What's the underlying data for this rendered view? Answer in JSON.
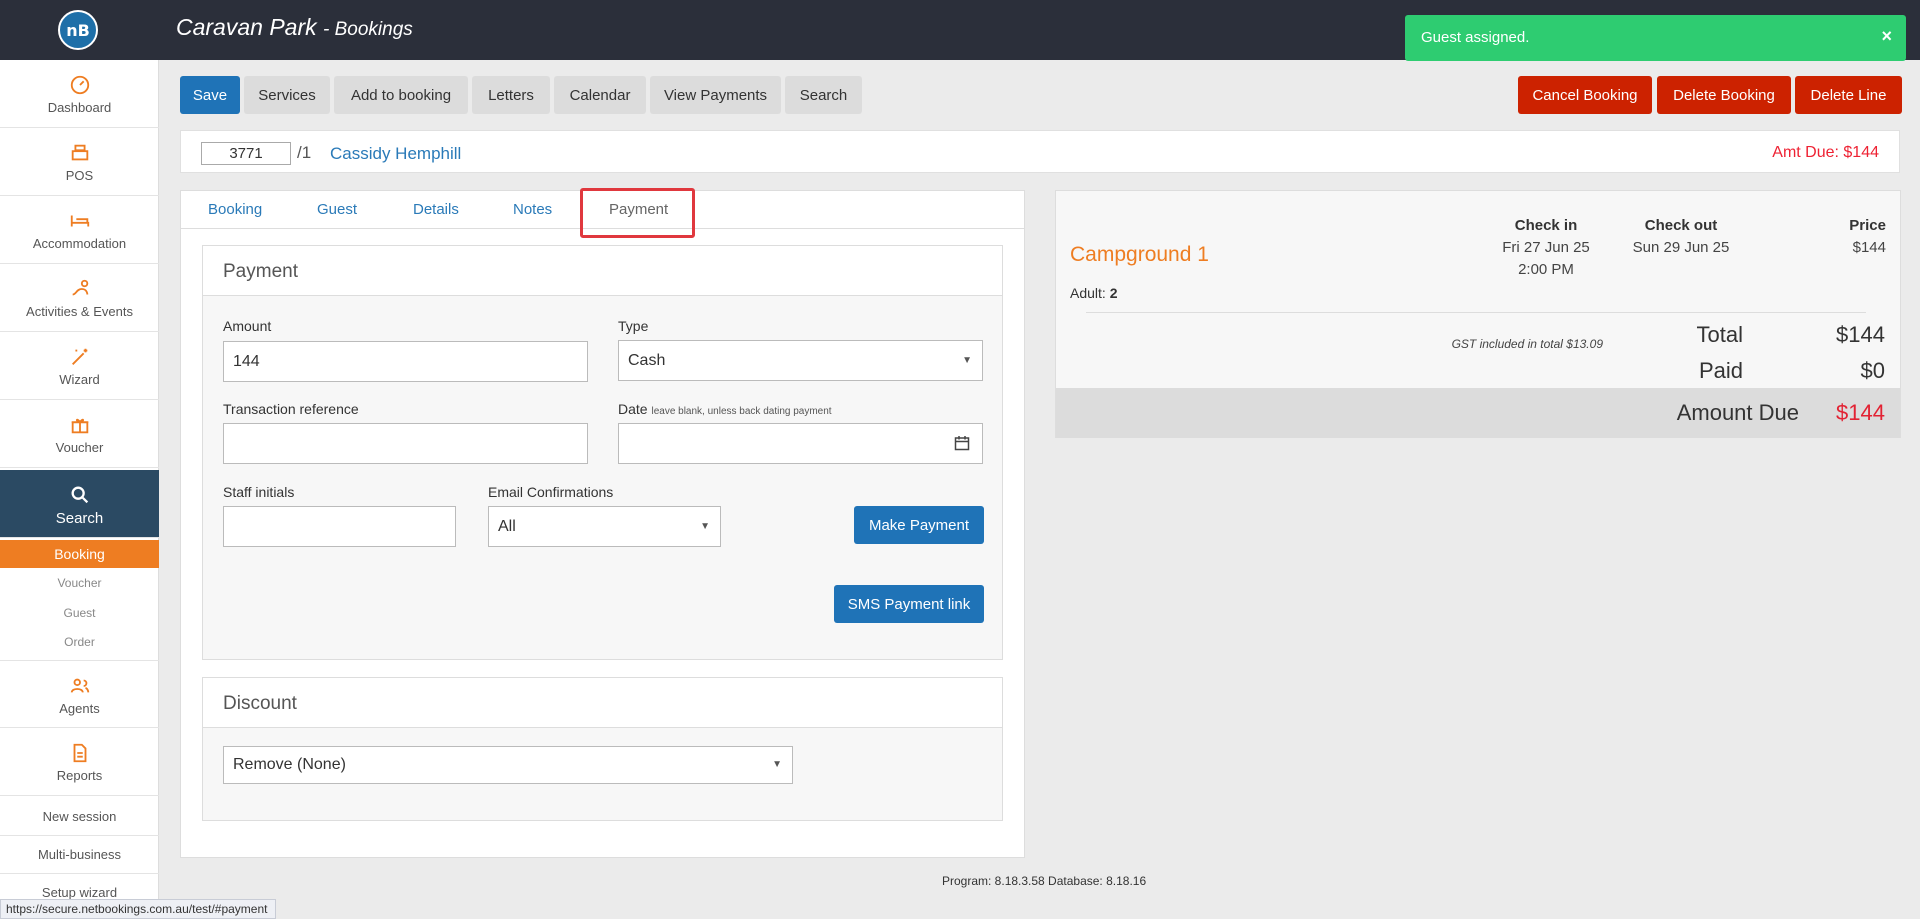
{
  "header": {
    "logo_text": "nB",
    "title": "Caravan Park",
    "subtitle": "- Bookings"
  },
  "toast": {
    "message": "Guest assigned.",
    "close": "×"
  },
  "sidebar": {
    "items": [
      {
        "label": "Dashboard",
        "icon": "dashboard-icon"
      },
      {
        "label": "POS",
        "icon": "register-icon"
      },
      {
        "label": "Accommodation",
        "icon": "bed-icon"
      },
      {
        "label": "Activities & Events",
        "icon": "activities-icon"
      },
      {
        "label": "Wizard",
        "icon": "wand-icon"
      },
      {
        "label": "Voucher",
        "icon": "gift-icon"
      },
      {
        "label": "Search",
        "icon": "search-icon"
      },
      {
        "label": "Agents",
        "icon": "agents-icon"
      },
      {
        "label": "Reports",
        "icon": "report-icon"
      }
    ],
    "sub": [
      "Booking",
      "Voucher",
      "Guest",
      "Order"
    ],
    "links": [
      "New session",
      "Multi-business",
      "Setup wizard"
    ]
  },
  "toolbar": {
    "save": "Save",
    "services": "Services",
    "add_to_booking": "Add to booking",
    "letters": "Letters",
    "calendar": "Calendar",
    "view_payments": "View Payments",
    "search": "Search",
    "cancel_booking": "Cancel Booking",
    "delete_booking": "Delete Booking",
    "delete_line": "Delete Line"
  },
  "booking": {
    "number": "3771",
    "suffix": "/1",
    "guest_name": "Cassidy Hemphill",
    "amt_due": "Amt Due: $144"
  },
  "tabs": [
    "Booking",
    "Guest",
    "Details",
    "Notes",
    "Payment"
  ],
  "payment": {
    "title": "Payment",
    "amount_label": "Amount",
    "amount_value": "144",
    "type_label": "Type",
    "type_value": "Cash",
    "txref_label": "Transaction reference",
    "txref_value": "",
    "date_label": "Date",
    "date_hint": "leave blank, unless back dating payment",
    "date_value": "",
    "staff_label": "Staff initials",
    "staff_value": "",
    "email_label": "Email Confirmations",
    "email_value": "All",
    "make_payment": "Make Payment",
    "sms_link": "SMS Payment link"
  },
  "discount": {
    "title": "Discount",
    "value": "Remove (None)"
  },
  "summary": {
    "site": "Campground 1",
    "adult_label": "Adult:",
    "adult_count": "2",
    "checkin_label": "Check in",
    "checkin_date": "Fri 27 Jun 25",
    "checkin_time": "2:00 PM",
    "checkout_label": "Check out",
    "checkout_date": "Sun 29 Jun 25",
    "price_label": "Price",
    "price_value": "$144",
    "gst_note": "GST included in total $13.09",
    "total_label": "Total",
    "total_value": "$144",
    "paid_label": "Paid",
    "paid_value": "$0",
    "due_label": "Amount Due",
    "due_value": "$144"
  },
  "footer": "Program: 8.18.3.58 Database: 8.18.16",
  "statusbar": "https://secure.netbookings.com.au/test/#payment",
  "colors": {
    "topbar": "#2b2f3a",
    "accent_orange": "#ee7d22",
    "primary_blue": "#1f73b7",
    "danger_red": "#cc2200",
    "toast_green": "#2ecc71",
    "due_red": "#e22233"
  }
}
